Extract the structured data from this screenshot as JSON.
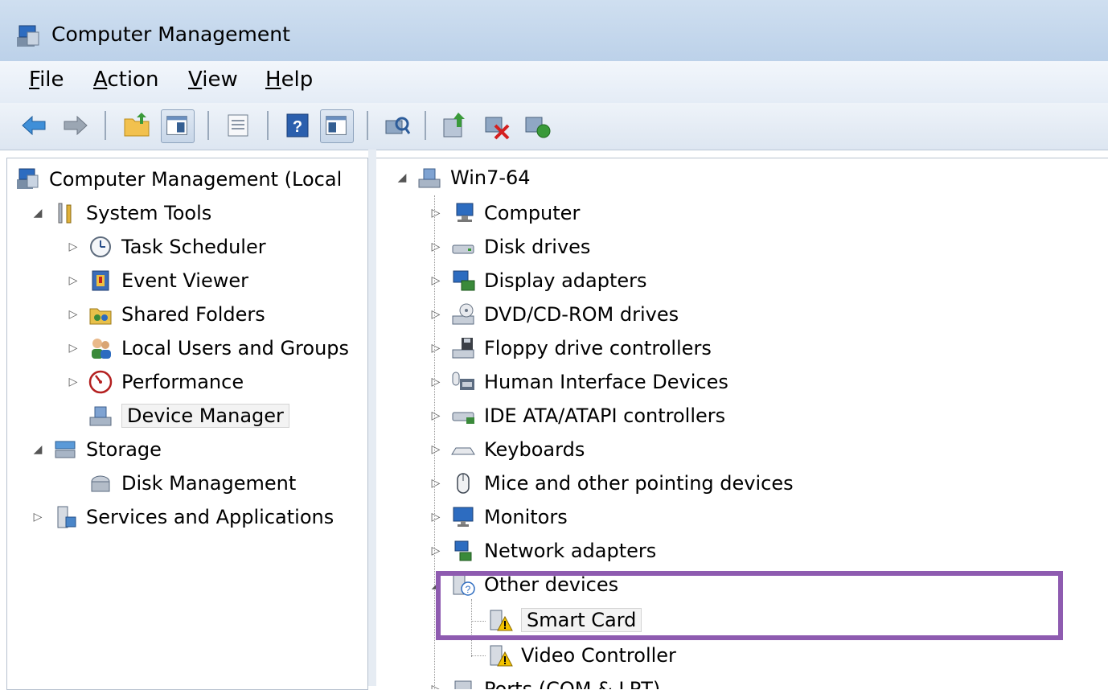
{
  "window": {
    "title": "Computer Management"
  },
  "menu": {
    "items": [
      {
        "label": "File",
        "u": "F",
        "rest": "ile"
      },
      {
        "label": "Action",
        "u": "A",
        "rest": "ction"
      },
      {
        "label": "View",
        "u": "V",
        "rest": "iew"
      },
      {
        "label": "Help",
        "u": "H",
        "rest": "elp"
      }
    ]
  },
  "toolbar": {
    "icons": [
      "back-arrow-icon",
      "forward-arrow-icon",
      "up-folder-icon",
      "show-hide-console-tree-icon",
      "properties-icon",
      "help-icon",
      "show-hide-action-pane-icon",
      "scan-hardware-icon",
      "update-driver-icon",
      "uninstall-icon",
      "enable-device-icon"
    ]
  },
  "left_tree": {
    "root": "Computer Management (Local",
    "items": [
      {
        "label": "System Tools",
        "level": 1,
        "expand": "open"
      },
      {
        "label": "Task Scheduler",
        "level": 2,
        "expand": "closed"
      },
      {
        "label": "Event Viewer",
        "level": 2,
        "expand": "closed"
      },
      {
        "label": "Shared Folders",
        "level": 2,
        "expand": "closed"
      },
      {
        "label": "Local Users and Groups",
        "level": 2,
        "expand": "closed"
      },
      {
        "label": "Performance",
        "level": 2,
        "expand": "closed"
      },
      {
        "label": "Device Manager",
        "level": 2,
        "expand": "none",
        "selected": true
      },
      {
        "label": "Storage",
        "level": 1,
        "expand": "open"
      },
      {
        "label": "Disk Management",
        "level": 2,
        "expand": "none"
      },
      {
        "label": "Services and Applications",
        "level": 1,
        "expand": "closed"
      }
    ]
  },
  "device_tree": {
    "root": "Win7-64",
    "categories": [
      "Computer",
      "Disk drives",
      "Display adapters",
      "DVD/CD-ROM drives",
      "Floppy drive controllers",
      "Human Interface Devices",
      "IDE ATA/ATAPI controllers",
      "Keyboards",
      "Mice and other pointing devices",
      "Monitors",
      "Network adapters"
    ],
    "other_devices": {
      "label": "Other devices",
      "children": [
        "Smart Card",
        "Video Controller"
      ]
    },
    "cut_off": "Ports (COM & LPT)"
  },
  "colors": {
    "highlight_box": "#8e5bb0",
    "titlebar": "#c7d9ee"
  }
}
